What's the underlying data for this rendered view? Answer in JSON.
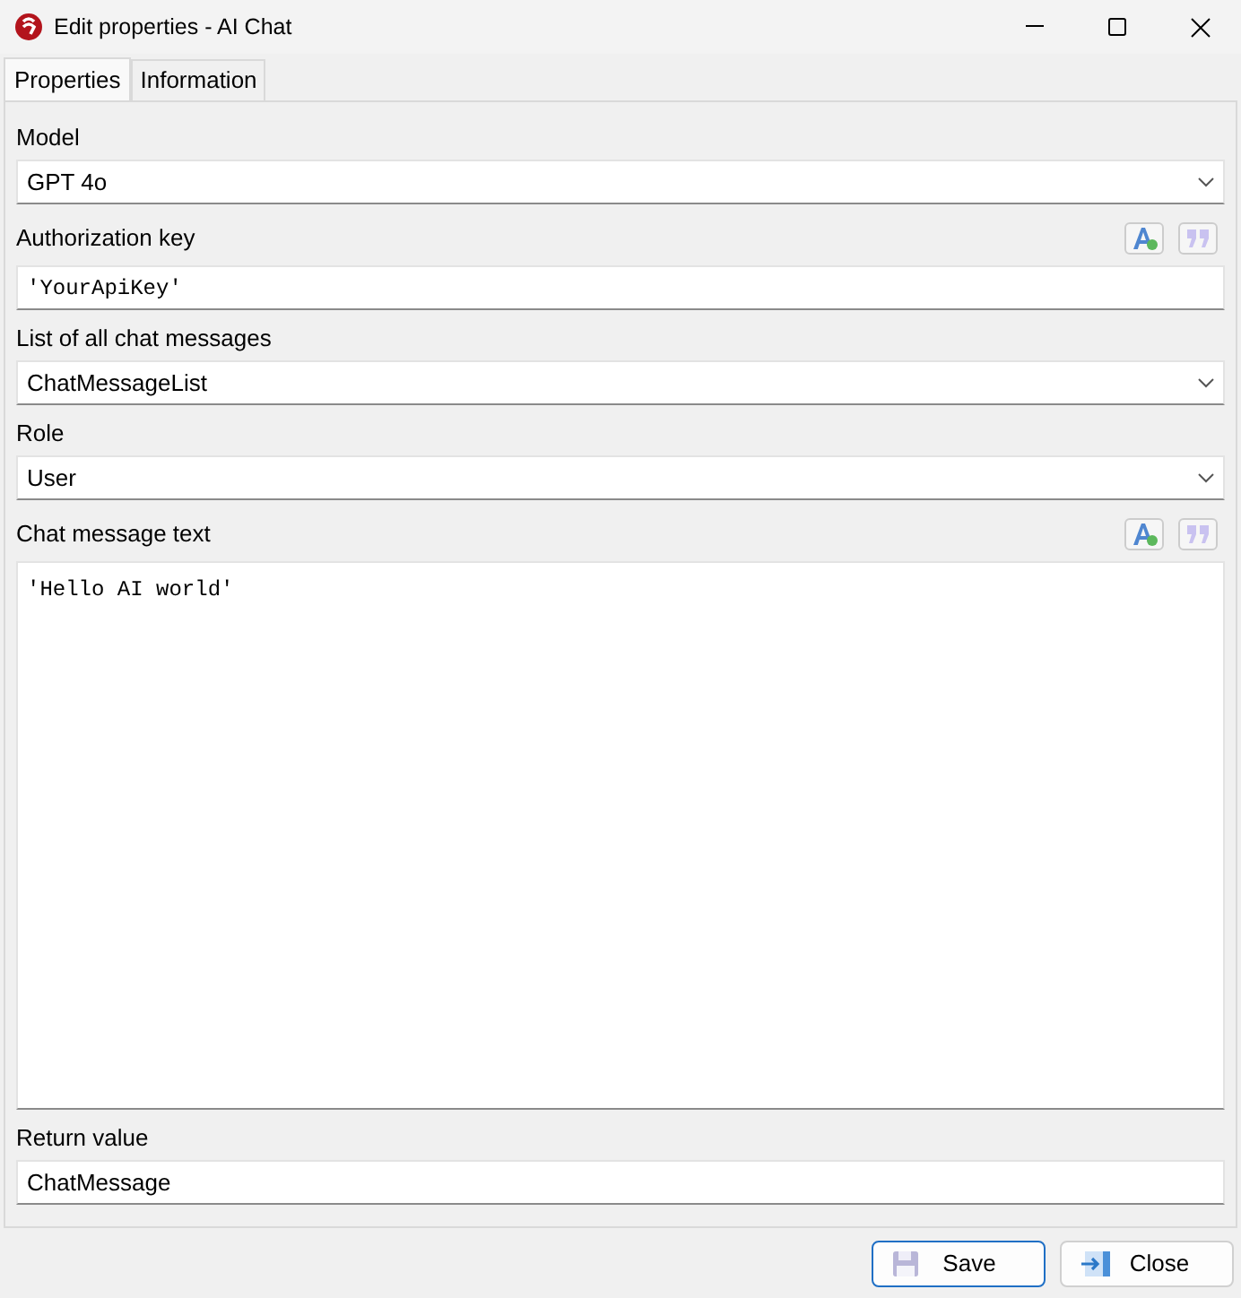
{
  "window": {
    "title": "Edit properties - AI Chat"
  },
  "tabs": [
    {
      "label": "Properties",
      "selected": true
    },
    {
      "label": "Information",
      "selected": false
    }
  ],
  "fields": [
    {
      "kind": "select",
      "label": "Model",
      "value": "GPT 4o"
    },
    {
      "kind": "text",
      "label": "Authorization key",
      "value": "'YourApiKey'",
      "expression_tools": true
    },
    {
      "kind": "select",
      "label": "List of all chat messages",
      "value": "ChatMessageList"
    },
    {
      "kind": "select",
      "label": "Role",
      "value": "User"
    },
    {
      "kind": "textarea",
      "label": "Chat message text",
      "value": "'Hello AI world'",
      "expression_tools": true
    },
    {
      "kind": "plain",
      "label": "Return value",
      "value": "ChatMessage"
    }
  ],
  "buttons": [
    {
      "kind": "save",
      "label": "Save",
      "selected": true
    },
    {
      "kind": "close",
      "label": "Close",
      "selected": false
    }
  ]
}
